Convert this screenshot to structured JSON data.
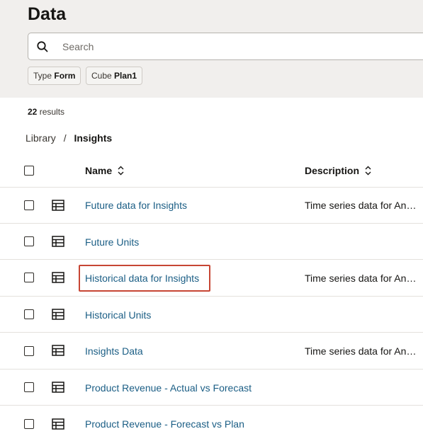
{
  "page": {
    "title": "Data"
  },
  "search": {
    "placeholder": "Search",
    "value": ""
  },
  "filters": [
    {
      "label": "Type",
      "value": "Form"
    },
    {
      "label": "Cube",
      "value": "Plan1"
    }
  ],
  "results": {
    "count": "22",
    "label": "results"
  },
  "breadcrumb": {
    "root": "Library",
    "separator": "/",
    "current": "Insights"
  },
  "table": {
    "columns": {
      "name": "Name",
      "description": "Description"
    },
    "rows": [
      {
        "name": "Future data for Insights",
        "description": "Time series data for Analysis"
      },
      {
        "name": "Future Units",
        "description": ""
      },
      {
        "name": "Historical data for Insights",
        "description": "Time series data for Analysis"
      },
      {
        "name": "Historical Units",
        "description": ""
      },
      {
        "name": "Insights Data",
        "description": "Time series data for Analysis"
      },
      {
        "name": "Product Revenue - Actual vs Forecast",
        "description": ""
      },
      {
        "name": "Product Revenue - Forecast vs Plan",
        "description": ""
      }
    ]
  },
  "colors": {
    "link": "#1b5e85",
    "highlight": "#c74634",
    "header_bg": "#f1efed"
  }
}
